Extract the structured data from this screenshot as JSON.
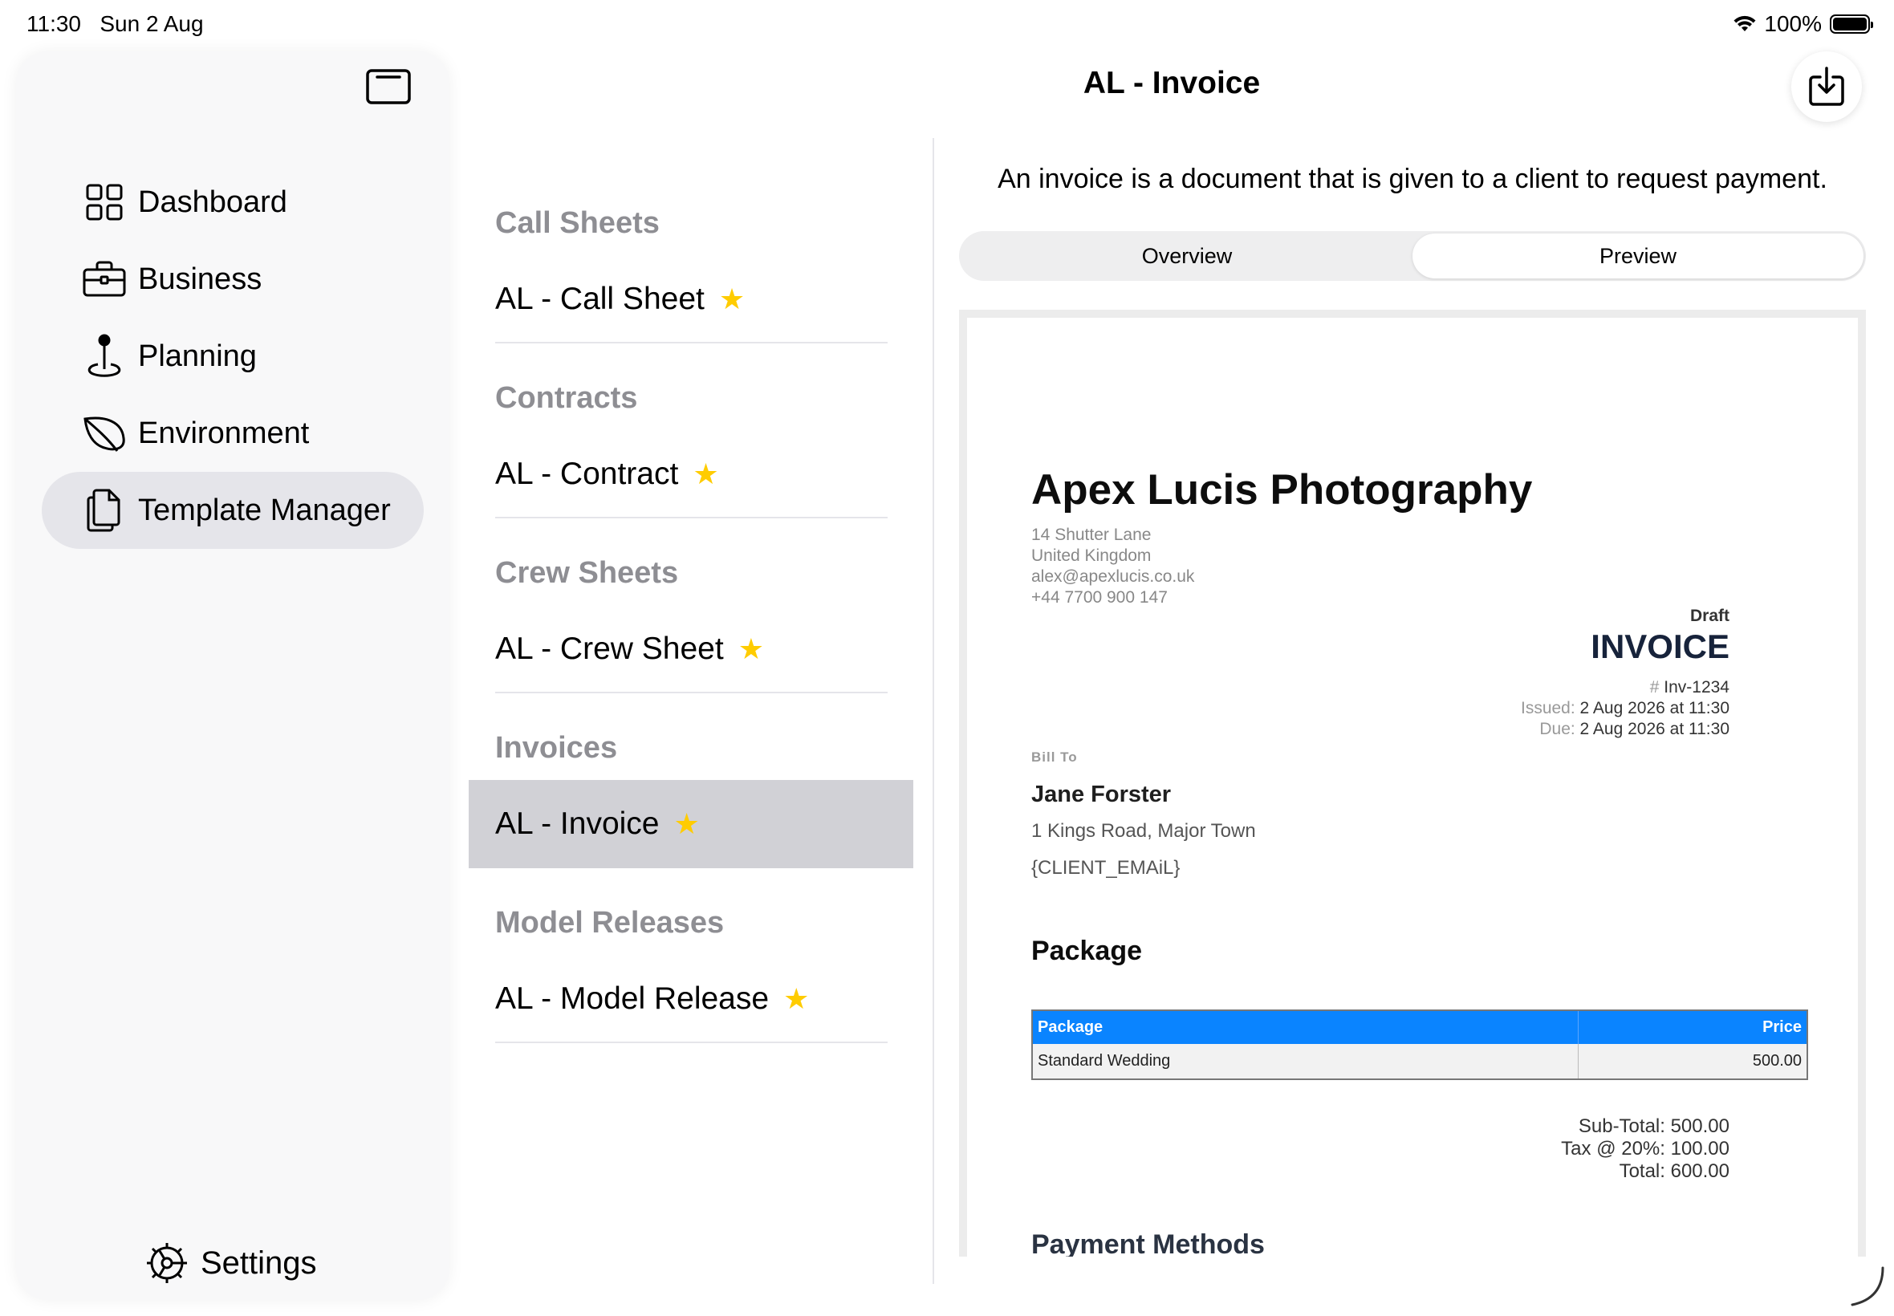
{
  "status_bar": {
    "time": "11:30",
    "date": "Sun 2 Aug",
    "battery": "100%"
  },
  "sidebar": {
    "items": [
      {
        "label": "Dashboard",
        "icon": "grid-icon"
      },
      {
        "label": "Business",
        "icon": "briefcase-icon"
      },
      {
        "label": "Planning",
        "icon": "map-pin-icon"
      },
      {
        "label": "Environment",
        "icon": "leaf-icon"
      },
      {
        "label": "Template Manager",
        "icon": "documents-icon",
        "selected": true
      }
    ],
    "settings_label": "Settings"
  },
  "header": {
    "title": "AL - Invoice"
  },
  "templates": {
    "sections": [
      {
        "title": "Call Sheets",
        "items": [
          "AL - Call Sheet"
        ]
      },
      {
        "title": "Contracts",
        "items": [
          "AL - Contract"
        ]
      },
      {
        "title": "Crew Sheets",
        "items": [
          "AL - Crew Sheet"
        ]
      },
      {
        "title": "Invoices",
        "items": [
          "AL - Invoice"
        ]
      },
      {
        "title": "Model Releases",
        "items": [
          "AL - Model Release"
        ]
      }
    ],
    "star": "★"
  },
  "detail": {
    "description": "An invoice is a document that is given to a client to request payment.",
    "tabs": [
      "Overview",
      "Preview"
    ],
    "active_tab": "Preview"
  },
  "document": {
    "company": "Apex Lucis Photography",
    "address_lines": [
      "14 Shutter Lane",
      "United Kingdom",
      "alex@apexlucis.co.uk",
      "+44 7700 900 147"
    ],
    "status": "Draft",
    "doc_title": "INVOICE",
    "number_label": "#",
    "number": "Inv-1234",
    "issued_label": "Issued:",
    "issued": "2 Aug 2026 at 11:30",
    "due_label": "Due:",
    "due": "2 Aug 2026 at 11:30",
    "bill_to": "Bill To",
    "client_name": "Jane Forster",
    "client_address": "1 Kings Road, Major Town",
    "client_email": "{CLIENT_EMAiL}",
    "package_heading": "Package",
    "table_headers": {
      "package": "Package",
      "price": "Price"
    },
    "table_rows": [
      {
        "package": "Standard Wedding",
        "price": "500.00"
      }
    ],
    "subtotal": "Sub-Total: 500.00",
    "tax": "Tax @ 20%: 100.00",
    "total": "Total: 600.00",
    "payment_heading": "Payment Methods"
  },
  "colors": {
    "accent": "#0a84ff",
    "star": "#ffcc00",
    "selected_row": "#d1d1d6"
  }
}
